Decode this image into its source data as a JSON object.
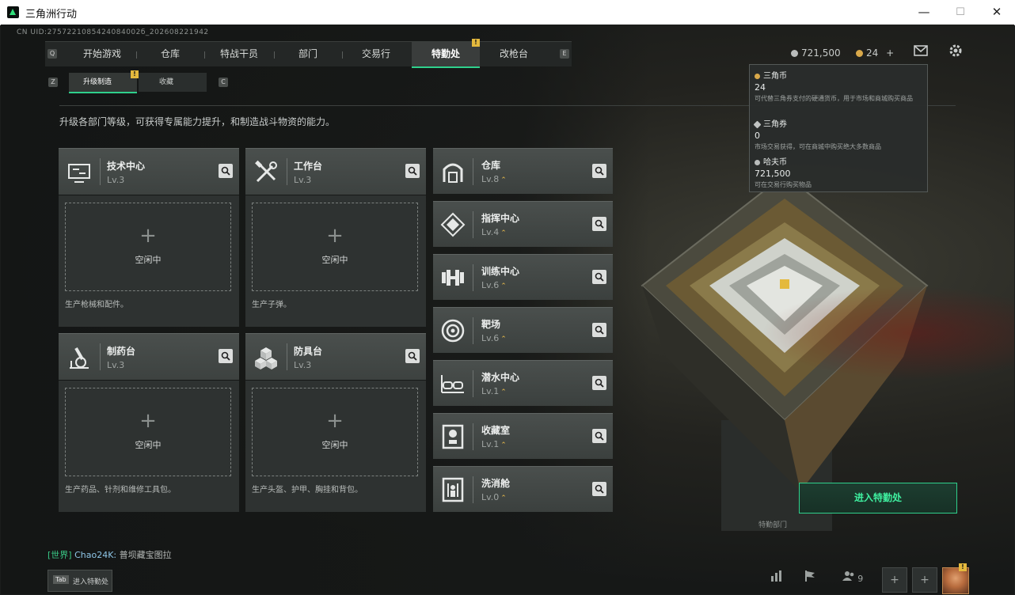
{
  "window": {
    "title": "三角洲行动",
    "minimize": "—",
    "maximize": "☐",
    "close": "✕"
  },
  "uid": "CN UID:2757221085424084002б_202608221942",
  "nav": {
    "left_key": "Q",
    "right_key": "E",
    "tabs": [
      "开始游戏",
      "仓库",
      "特战干员",
      "部门",
      "交易行",
      "特勤处",
      "改枪台"
    ],
    "active_tab": "特勤处",
    "badge": "!"
  },
  "currency": {
    "hafu": "721,500",
    "triangle": "24",
    "add": "+"
  },
  "subnav": {
    "left_key": "Z",
    "right_key": "C",
    "tabs": [
      "升级制造",
      "收藏"
    ],
    "badge": "!"
  },
  "description": "升级各部门等级，可获得专属能力提升，和制造战斗物资的能力。",
  "production": [
    {
      "name": "技术中心",
      "level": "Lv.3",
      "status": "空闲中",
      "plus": "+",
      "note": "生产枪械和配件。"
    },
    {
      "name": "工作台",
      "level": "Lv.3",
      "status": "空闲中",
      "plus": "+",
      "note": "生产子弹。"
    },
    {
      "name": "制药台",
      "level": "Lv.3",
      "status": "空闲中",
      "plus": "+",
      "note": "生产药品、针剂和维修工具包。"
    },
    {
      "name": "防具台",
      "level": "Lv.3",
      "status": "空闲中",
      "plus": "+",
      "note": "生产头盔、护甲、胸挂和背包。"
    }
  ],
  "facilities": [
    {
      "name": "仓库",
      "level": "Lv.8",
      "arrow": "⌃"
    },
    {
      "name": "指挥中心",
      "level": "Lv.4",
      "arrow": "⌃"
    },
    {
      "name": "训练中心",
      "level": "Lv.6",
      "arrow": "⌃"
    },
    {
      "name": "靶场",
      "level": "Lv.6",
      "arrow": "⌃"
    },
    {
      "name": "潜水中心",
      "level": "Lv.1",
      "arrow": "⌃"
    },
    {
      "name": "收藏室",
      "level": "Lv.1",
      "arrow": "⌃"
    },
    {
      "name": "洗消舱",
      "level": "Lv.0",
      "arrow": "⌃"
    }
  ],
  "tooltip": {
    "items": [
      {
        "name": "三角币",
        "value": "24",
        "desc": "可代替三角券支付的硬通货币，用于市场和商城购买商品"
      },
      {
        "name": "三角券",
        "value": "0",
        "desc": "市场交易获得，可在商城中购买绝大多数商品"
      },
      {
        "name": "哈夫币",
        "value": "721,500",
        "desc": "可在交易行购买物品"
      }
    ]
  },
  "enter_button": "进入特勤处",
  "dept_label": "特勤部门",
  "chat": {
    "channel": "[世界]",
    "user": "Chao24K:",
    "message": "普坝藏宝图拉"
  },
  "tab_hint": {
    "key": "Tab",
    "label": "进入特勤处"
  },
  "bottom": {
    "friends_count": "9",
    "avatar_badge": "!"
  },
  "colors": {
    "accent": "#2fd08c",
    "badge": "#e4b93d",
    "upgrade": "#e6b94b"
  }
}
